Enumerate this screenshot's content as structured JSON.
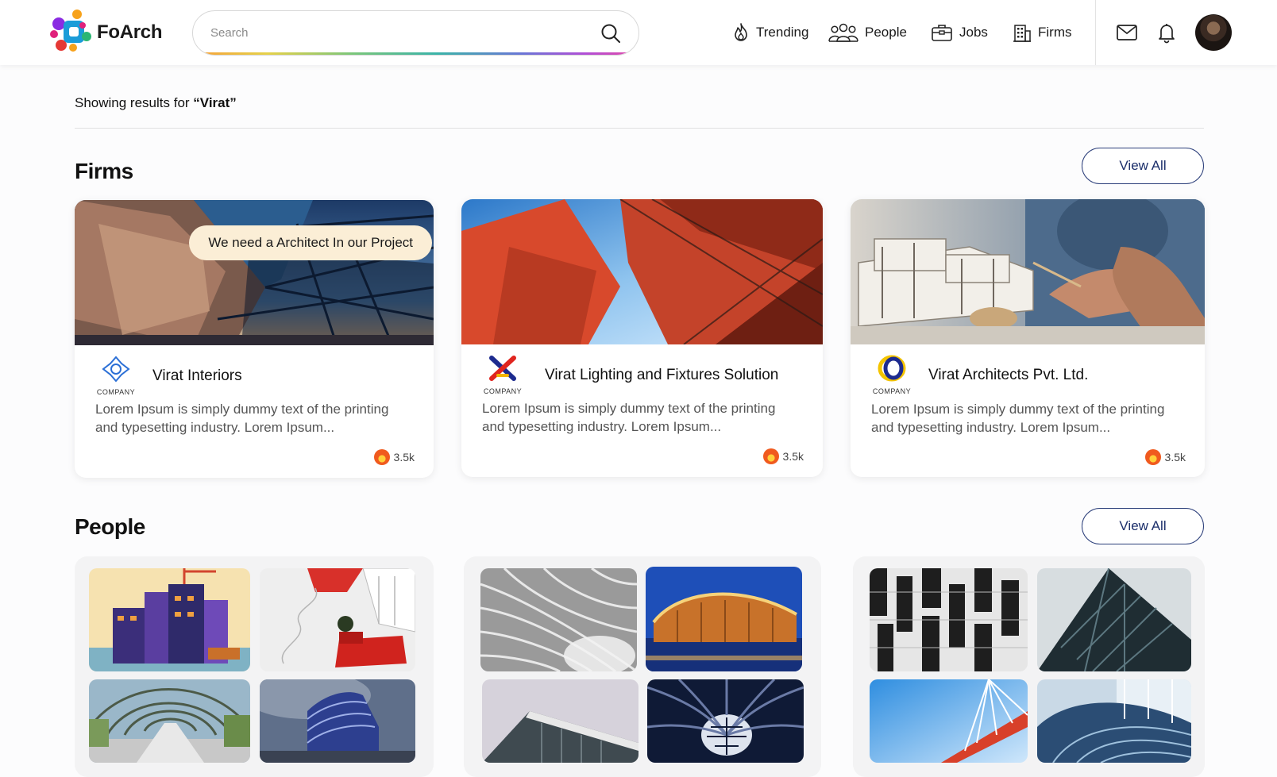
{
  "brand": {
    "name": "FoArch"
  },
  "search": {
    "placeholder": "Search",
    "value": ""
  },
  "nav": [
    {
      "label": "Trending",
      "icon": "flame-icon"
    },
    {
      "label": "People",
      "icon": "people-icon"
    },
    {
      "label": "Jobs",
      "icon": "briefcase-icon"
    },
    {
      "label": "Firms",
      "icon": "building-icon"
    }
  ],
  "header_icons": [
    "mail-icon",
    "bell-icon",
    "avatar"
  ],
  "results": {
    "prefix": "Showing results for ",
    "query": "“Virat”"
  },
  "sections": {
    "firms": {
      "title": "Firms",
      "view_all": "View All"
    },
    "people": {
      "title": "People",
      "view_all": "View All"
    }
  },
  "firms": [
    {
      "name": "Virat Interiors",
      "tag": "We need a Architect In our Project",
      "logo_word": "COMPANY",
      "description": "Lorem Ipsum is simply dummy text of the printing and typesetting industry. Lorem Ipsum...",
      "likes": "3.5k"
    },
    {
      "name": "Virat Lighting and Fixtures Solution",
      "tag": "",
      "logo_word": "COMPANY",
      "description": "Lorem Ipsum is simply dummy text of the printing and typesetting industry. Lorem Ipsum...",
      "likes": "3.5k"
    },
    {
      "name": "Virat Architects Pvt. Ltd.",
      "tag": "",
      "logo_word": "COMPANY",
      "description": "Lorem Ipsum is simply dummy text of the printing and typesetting industry. Lorem Ipsum...",
      "likes": "3.5k"
    }
  ],
  "colors": {
    "accent_navy": "#1c2f6b",
    "tag_bg": "#fbeed6",
    "like_orange": "#f05a1e"
  }
}
